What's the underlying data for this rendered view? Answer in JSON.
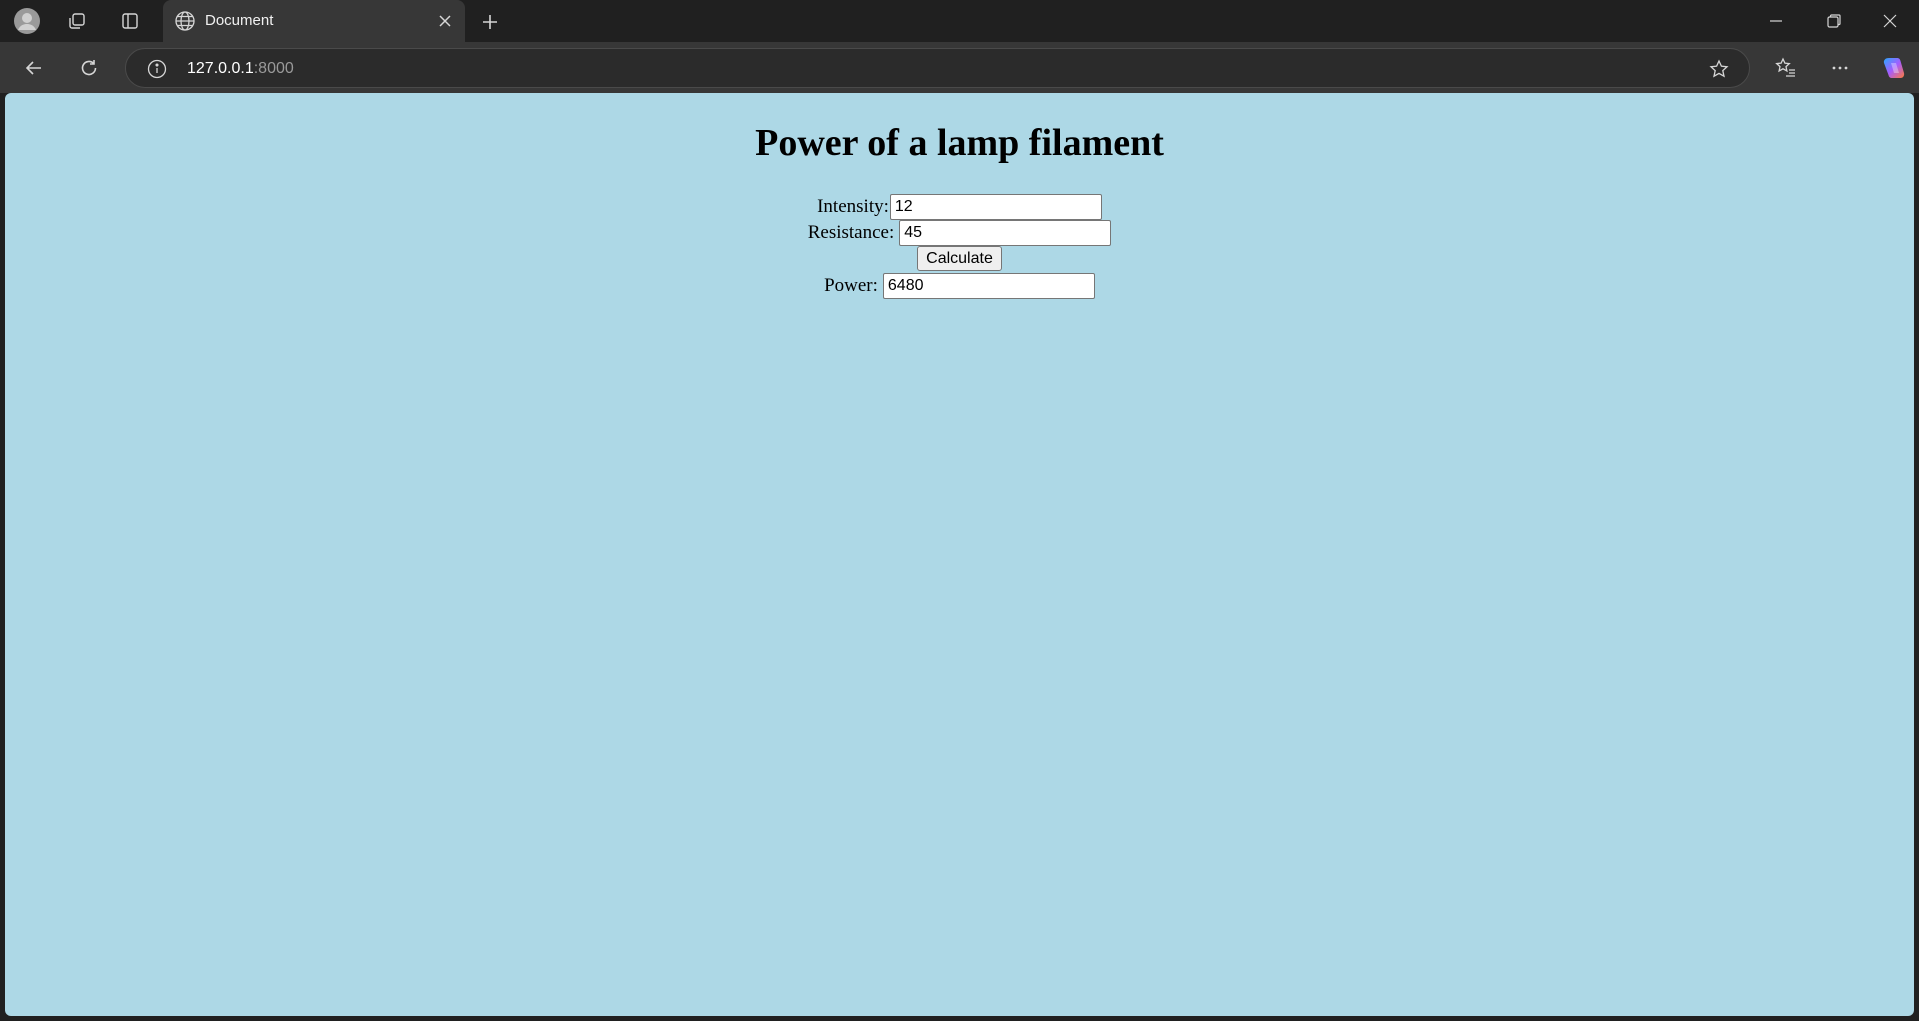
{
  "browser": {
    "tab_title": "Document",
    "url_host": "127.0.0.1",
    "url_port": ":8000"
  },
  "page": {
    "title": "Power of a lamp filament",
    "intensity_label": "Intensity:",
    "intensity_value": "12",
    "resistance_label": "Resistance:",
    "resistance_value": "45",
    "calculate_label": "Calculate",
    "power_label": "Power:",
    "power_value": "6480",
    "background_color": "#add8e6"
  }
}
